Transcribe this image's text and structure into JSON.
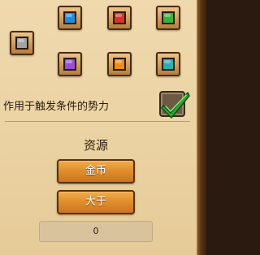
{
  "swatches": [
    {
      "name": "gray",
      "color": "#a4a4a4"
    },
    {
      "name": "blue",
      "color": "#1e8de0"
    },
    {
      "name": "red",
      "color": "#d8322c"
    },
    {
      "name": "green",
      "color": "#39b23b"
    },
    {
      "name": "purple",
      "color": "#9a4fd3"
    },
    {
      "name": "orange",
      "color": "#ef8a1e"
    },
    {
      "name": "teal",
      "color": "#2aaeb0"
    }
  ],
  "faction_trigger": {
    "label": "作用于触发条件的势力",
    "checked": true,
    "check_icon": "checkmark-icon"
  },
  "resource": {
    "title": "资源",
    "type_button_label": "金币",
    "compare_button_label": "大于",
    "amount_value": "0"
  },
  "colors": {
    "button_orange": "#e08f2d",
    "panel_bg": "#ebd3a4",
    "check_green": "#2fa82f"
  }
}
